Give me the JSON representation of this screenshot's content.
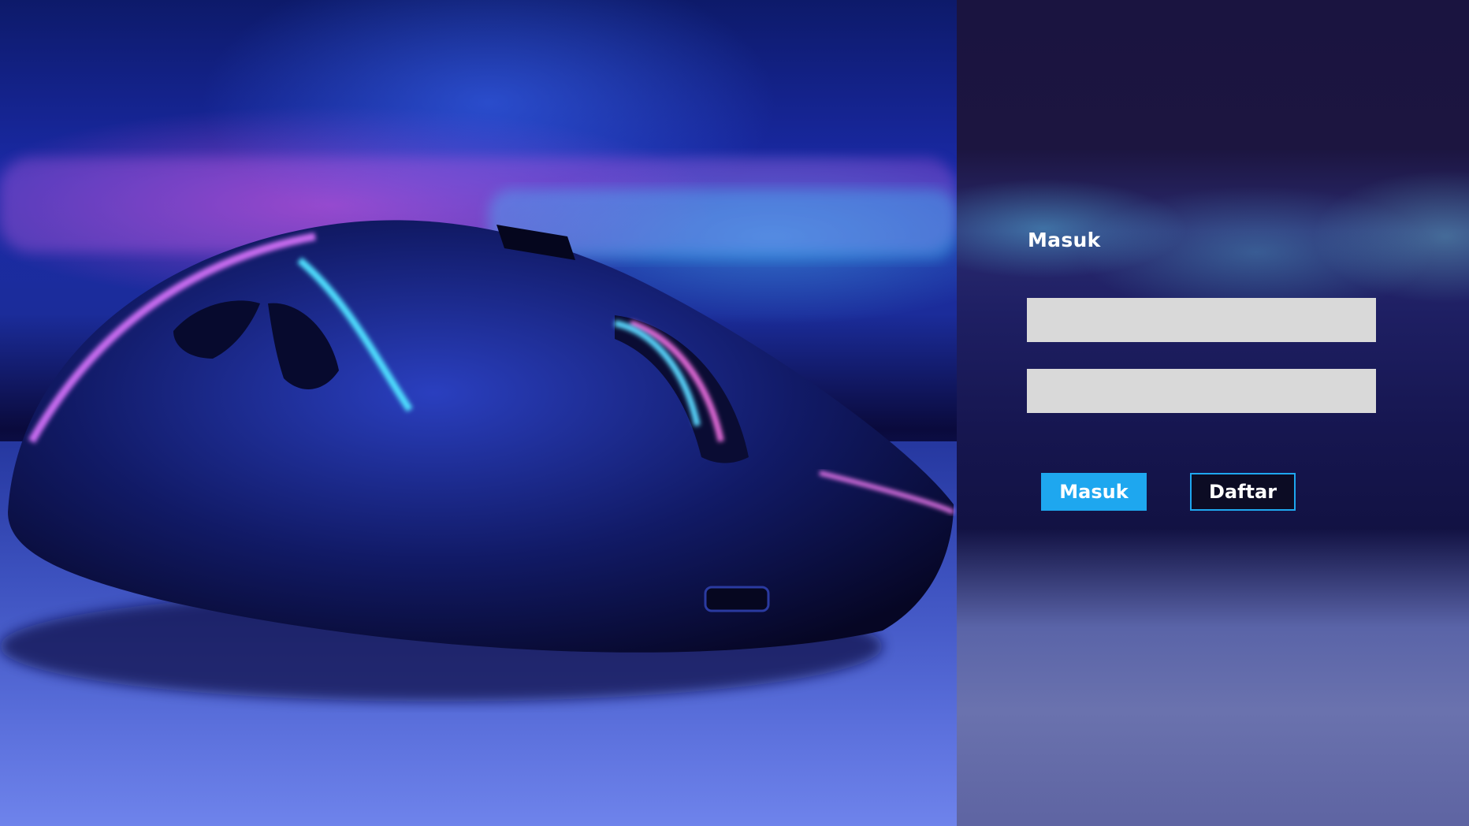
{
  "hero": {
    "image_label": "gaming-mouse-photo"
  },
  "login": {
    "title": "Masuk",
    "username": {
      "value": "",
      "placeholder": ""
    },
    "password": {
      "value": "",
      "placeholder": ""
    },
    "login_button_label": "Masuk",
    "register_button_label": "Daftar"
  },
  "colors": {
    "accent": "#1ea7ef",
    "field_bg": "#d9d9d9",
    "text": "#ffffff"
  }
}
